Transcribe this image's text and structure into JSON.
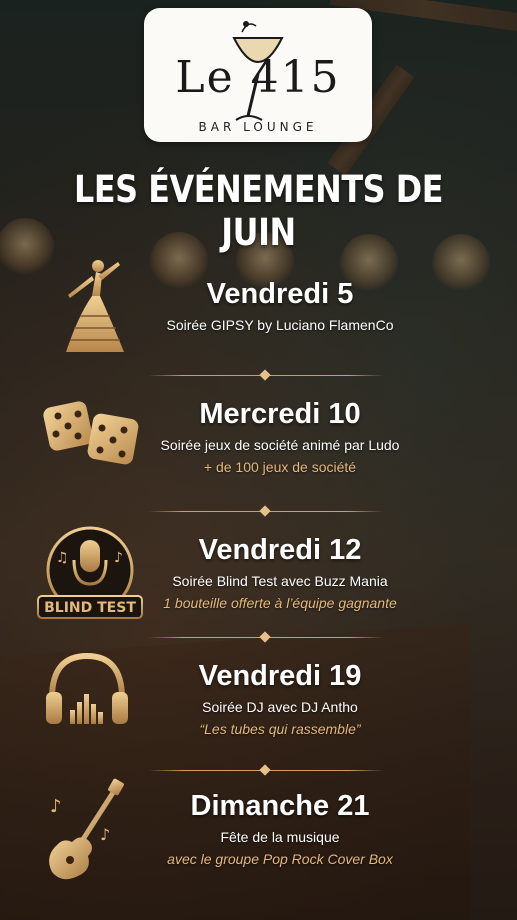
{
  "logo": {
    "name": "Le 415",
    "subtitle": "BAR LOUNGE"
  },
  "title": "LES ÉVÉNEMENTS DE JUIN",
  "events": [
    {
      "day": "Vendredi 5",
      "description": "Soirée GIPSY by Luciano FlamenCo",
      "note": "",
      "icon": "flamenco-dancer-icon"
    },
    {
      "day": "Mercredi 10",
      "description": "Soirée jeux de société animé par Ludo",
      "note": "+ de 100 jeux de société",
      "icon": "dice-icon"
    },
    {
      "day": "Vendredi 12",
      "description": "Soirée Blind Test avec Buzz Mania",
      "note": "1 bouteille offerte à l’équipe gagnante",
      "icon": "blind-test-microphone-icon",
      "badge": "BLIND TEST"
    },
    {
      "day": "Vendredi 19",
      "description": "Soirée DJ avec DJ Antho",
      "note": "“Les tubes qui rassemble”",
      "icon": "headphones-icon"
    },
    {
      "day": "Dimanche 21",
      "description": "Fête de la musique",
      "note": "avec le groupe Pop Rock Cover Box",
      "icon": "electric-guitar-icon"
    }
  ],
  "colors": {
    "gold": "#d9ad6c",
    "white": "#ffffff",
    "logo_bg": "#fbfaf7"
  }
}
